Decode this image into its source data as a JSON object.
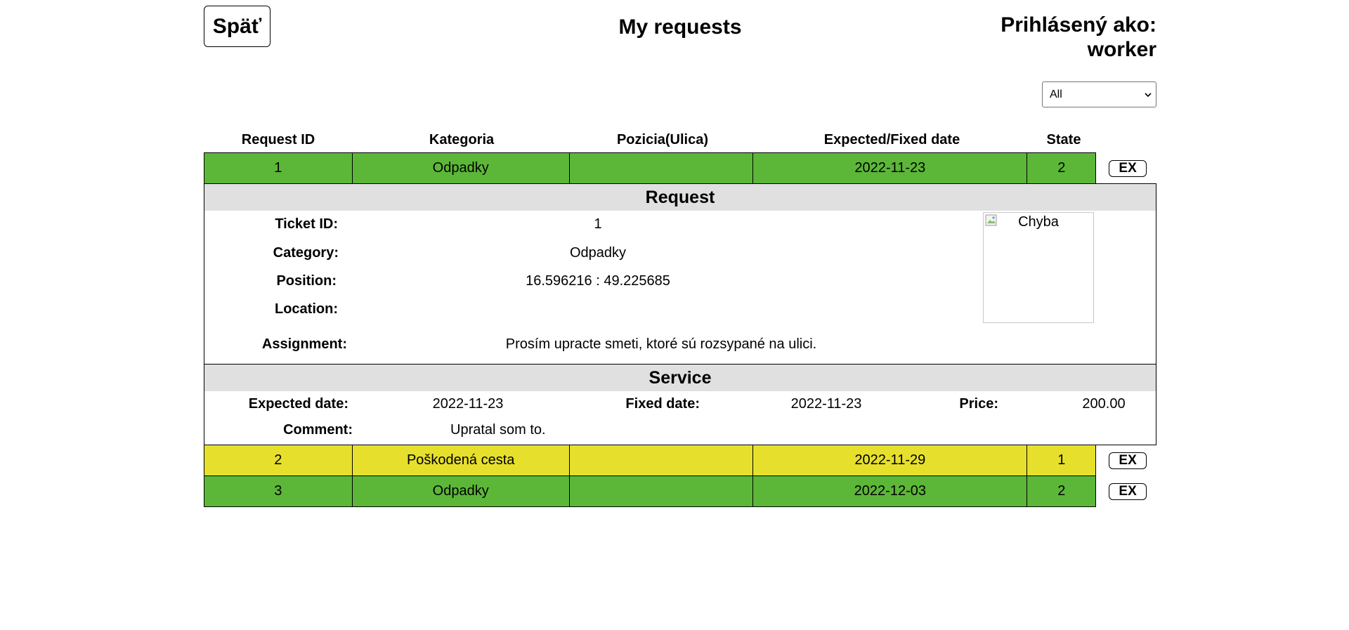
{
  "header": {
    "back_label": "Späť",
    "title": "My requests",
    "user_line1": "Prihlásený ako:",
    "user_line2": "worker"
  },
  "filter": {
    "selected": "All"
  },
  "columns": [
    "Request ID",
    "Kategoria",
    "Pozicia(Ulica)",
    "Expected/Fixed date",
    "State"
  ],
  "rows": [
    {
      "id": "1",
      "category": "Odpadky",
      "position": "",
      "date": "2022-11-23",
      "state": "2",
      "color": "#5cb738",
      "action": "EX"
    },
    {
      "id": "2",
      "category": "Poškodená cesta",
      "position": "",
      "date": "2022-11-29",
      "state": "1",
      "color": "#e6e02c",
      "action": "EX"
    },
    {
      "id": "3",
      "category": "Odpadky",
      "position": "",
      "date": "2022-12-03",
      "state": "2",
      "color": "#5cb738",
      "action": "EX"
    }
  ],
  "detail": {
    "request_title": "Request",
    "ticket_label": "Ticket ID:",
    "ticket_value": "1",
    "category_label": "Category:",
    "category_value": "Odpadky",
    "position_label": "Position:",
    "position_value": "16.596216 : 49.225685",
    "location_label": "Location:",
    "location_value": "",
    "assignment_label": "Assignment:",
    "assignment_value": "Prosím upracte smeti, ktoré sú rozsypané na ulici.",
    "image_alt": "Chyba",
    "service_title": "Service",
    "expected_label": "Expected date:",
    "expected_value": "2022-11-23",
    "fixed_label": "Fixed date:",
    "fixed_value": "2022-11-23",
    "price_label": "Price:",
    "price_value": "200.00",
    "comment_label": "Comment:",
    "comment_value": "Upratal som to."
  }
}
